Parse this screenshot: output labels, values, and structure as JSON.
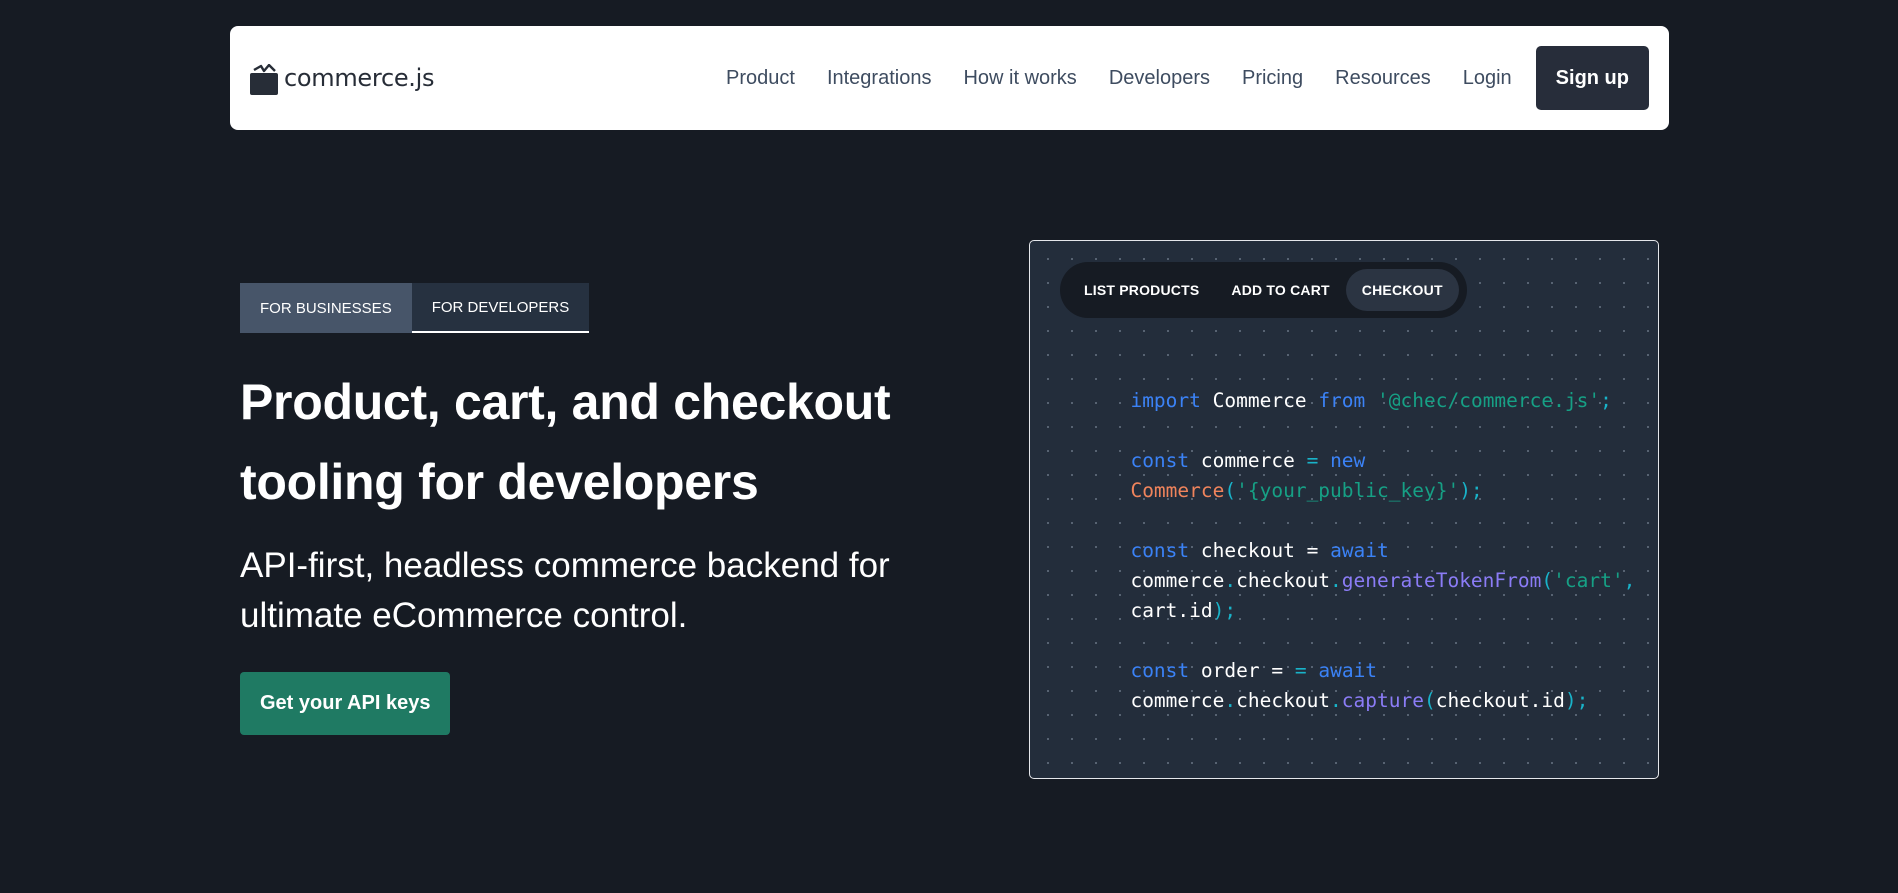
{
  "nav": {
    "logo_text": "commerce.js",
    "links": [
      "Product",
      "Integrations",
      "How it works",
      "Developers",
      "Pricing",
      "Resources",
      "Login"
    ],
    "signup_label": "Sign up"
  },
  "hero": {
    "tabs": [
      "FOR BUSINESSES",
      "FOR DEVELOPERS"
    ],
    "active_tab": "FOR DEVELOPERS",
    "headline_line1": "Product, cart, and checkout",
    "headline_line2": "tooling for developers",
    "subhead_line1": "API-first, headless commerce backend for",
    "subhead_line2": "ultimate eCommerce control.",
    "cta_label": "Get your API keys"
  },
  "code_panel": {
    "tabs": [
      "LIST PRODUCTS",
      "ADD TO CART",
      "CHECKOUT"
    ],
    "active_tab": "CHECKOUT",
    "code": {
      "l1": [
        "import",
        " Commerce ",
        "from",
        " ",
        "'@chec/commerce.js'",
        ";"
      ],
      "l2": [
        "const",
        " commerce ",
        "=",
        " ",
        "new"
      ],
      "l3": [
        "Commerce",
        "(",
        "'{your_public_key}'",
        ");"
      ],
      "l4": [
        "const",
        " checkout ",
        "=",
        " ",
        "await"
      ],
      "l5": [
        "commerce",
        ".",
        "checkout",
        ".",
        "generateTokenFrom",
        "(",
        "'cart'",
        ","
      ],
      "l6": [
        "cart.id",
        ");"
      ],
      "l7": [
        "const",
        " order ",
        "=",
        " ",
        "=",
        " ",
        "await"
      ],
      "l8": [
        "commerce",
        ".",
        "checkout",
        ".",
        "capture",
        "(",
        "checkout.id",
        ");"
      ]
    }
  },
  "colors": {
    "background": "#161b23",
    "primary_green": "#1f7a63",
    "nav_button": "#272d3a",
    "code_keyword": "#3b82f6",
    "code_string": "#16a085",
    "code_class": "#f0845c",
    "code_function": "#8b7cf6"
  },
  "icons": {
    "logo": "shopping-bag-icon"
  }
}
